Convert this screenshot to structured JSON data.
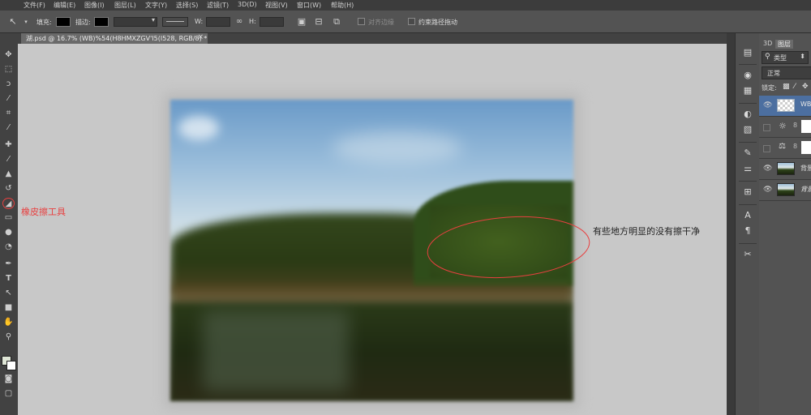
{
  "menu": [
    "文件(F)",
    "编辑(E)",
    "图像(I)",
    "图层(L)",
    "文字(Y)",
    "选择(S)",
    "滤镜(T)",
    "3D(D)",
    "视图(V)",
    "窗口(W)",
    "帮助(H)"
  ],
  "options_bar": {
    "fill_label": "填充:",
    "stroke_label": "描边:",
    "w_label": "W:",
    "h_label": "H:",
    "align_edges_label": "对齐边缘",
    "constrain_path_label": "约束路径拖动"
  },
  "document_tab": {
    "title": "湖.psd @ 16.7% (WB)%54(H8HMXZGV'I5(I528, RGB/8) *",
    "close": "×"
  },
  "panel": {
    "tab_3d": "3D",
    "tab_layers": "图层",
    "kind_filter": "类型",
    "blend_mode": "正常",
    "lock_label": "锁定:",
    "layers": [
      {
        "name": "WB",
        "visible": true
      },
      {
        "name": "",
        "visible": false
      },
      {
        "name": "",
        "visible": false
      },
      {
        "name": "背景",
        "visible": true
      },
      {
        "name": "背景",
        "visible": true
      }
    ]
  },
  "annotations": {
    "left": "橡皮擦工具",
    "right": "有些地方明显的没有擦干净"
  },
  "icons": {
    "toolbar": [
      "move-icon",
      "marquee-icon",
      "lasso-icon",
      "quick-select-icon",
      "crop-icon",
      "eyedropper-icon",
      "healing-brush-icon",
      "brush-icon",
      "clone-stamp-icon",
      "history-brush-icon",
      "eraser-icon",
      "gradient-icon",
      "blur-icon",
      "dodge-icon",
      "pen-icon",
      "type-icon",
      "path-select-icon",
      "shape-icon",
      "hand-icon",
      "zoom-icon"
    ]
  },
  "colors": {
    "annotation_red": "#e84040",
    "app_bg": "#535353",
    "canvas_bg": "#c8c8c8"
  }
}
